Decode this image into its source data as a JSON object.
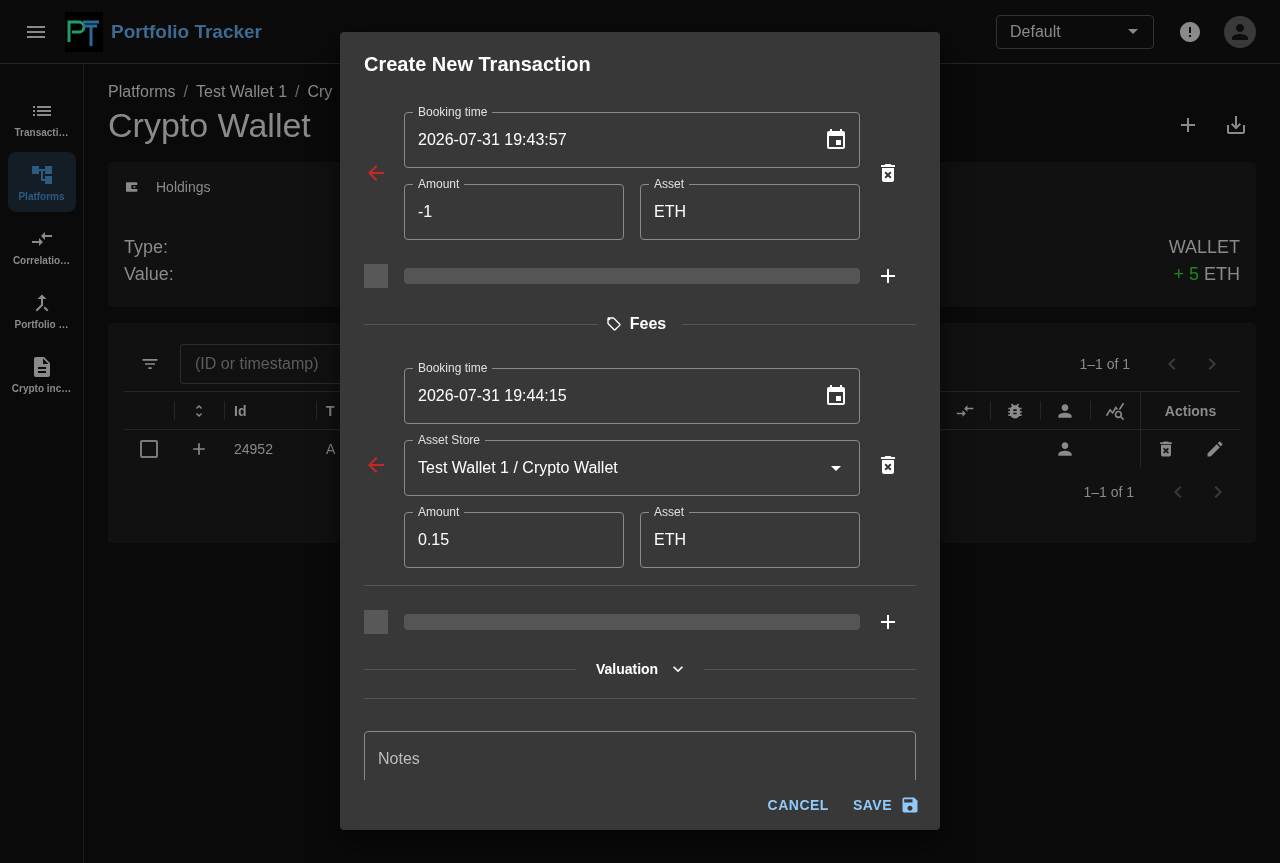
{
  "app_bar": {
    "title": "Portfolio Tracker",
    "portfolio_select": {
      "value": "Default"
    }
  },
  "nav": [
    {
      "label": "Transacti…",
      "selected": false
    },
    {
      "label": "Platforms",
      "selected": true
    },
    {
      "label": "Correlatio…",
      "selected": false
    },
    {
      "label": "Portfolio …",
      "selected": false
    },
    {
      "label": "Crypto inc…",
      "selected": false
    }
  ],
  "page": {
    "breadcrumb": [
      "Platforms",
      "Test Wallet 1",
      "Cry"
    ],
    "breadcrumb_separator": "/",
    "title": "Crypto Wallet"
  },
  "holdings": {
    "title": "Holdings",
    "type_label": "Type:",
    "value_label": "Value:",
    "type": "WALLET",
    "value_amount": "+ 5",
    "value_unit": "ETH"
  },
  "table": {
    "filter_placeholder": "(ID or timestamp)",
    "pagination_top": "1–1 of 1",
    "columns": [
      "Id",
      "T"
    ],
    "actions_column": "Actions",
    "rows": [
      {
        "checked": false,
        "id": "24952",
        "column_2": "A"
      }
    ],
    "pagination_bottom": "1–1 of 1"
  },
  "dialog": {
    "title": "Create New Transaction",
    "entries": [
      {
        "kind": "transaction",
        "booking_time": {
          "label": "Booking time",
          "value": "2026-07-31 19:43:57"
        },
        "amount": {
          "label": "Amount",
          "value": "-1"
        },
        "asset": {
          "label": "Asset",
          "value": "ETH"
        }
      },
      {
        "kind": "fee",
        "heading": "Fees",
        "booking_time": {
          "label": "Booking time",
          "value": "2026-07-31 19:44:15"
        },
        "asset_store": {
          "label": "Asset Store",
          "value": "Test Wallet 1 / Crypto Wallet"
        },
        "amount": {
          "label": "Amount",
          "value": "0.15"
        },
        "asset": {
          "label": "Asset",
          "value": "ETH"
        }
      }
    ],
    "valuation": {
      "label": "Valuation",
      "expanded": false
    },
    "notes": {
      "placeholder": "Notes"
    },
    "buttons": {
      "cancel": "CANCEL",
      "save": "SAVE"
    }
  }
}
